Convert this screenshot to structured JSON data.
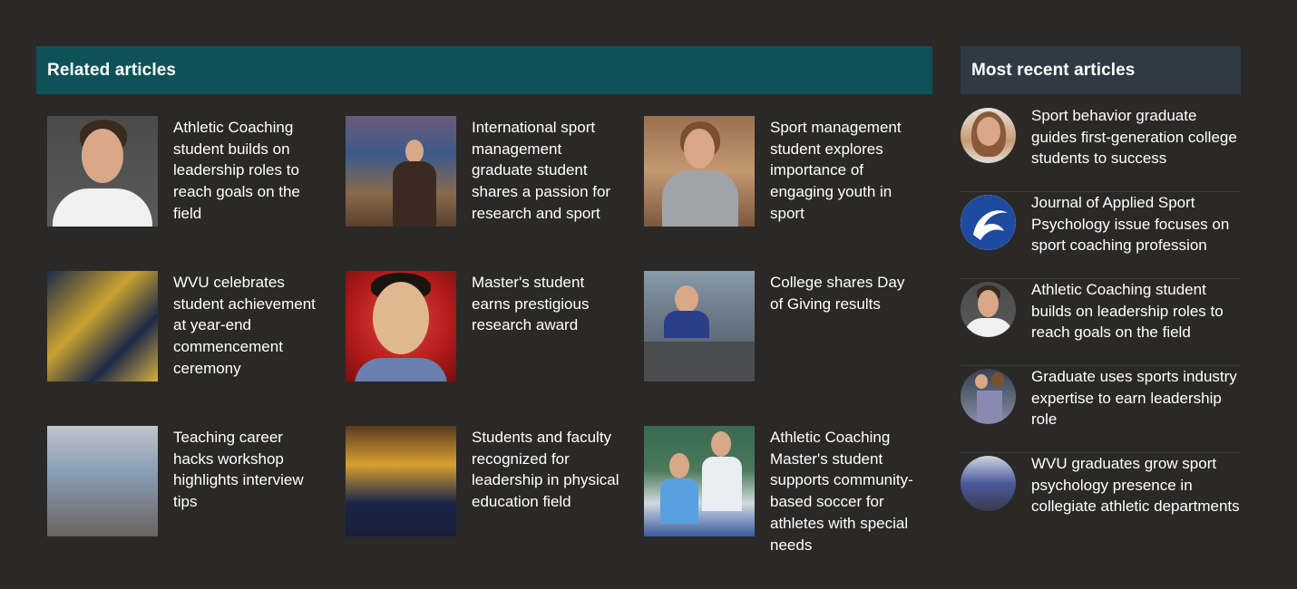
{
  "related": {
    "heading": "Related articles",
    "articles": [
      {
        "title": "Athletic Coaching student builds on leadership roles to reach goals on the field",
        "image": "student-portrait-photo"
      },
      {
        "title": "International sport management graduate student shares a passion for research and sport",
        "image": "arena-photo"
      },
      {
        "title": "Sport management student explores importance of engaging youth in sport",
        "image": "gym-portrait-photo"
      },
      {
        "title": "WVU celebrates student achievement at year-end commencement ceremony",
        "image": "commencement-photo"
      },
      {
        "title": "Master's student earns prestigious research award",
        "image": "smiling-student-photo"
      },
      {
        "title": "College shares Day of Giving results",
        "image": "meeting-photo"
      },
      {
        "title": "Teaching career hacks workshop highlights interview tips",
        "image": "workshop-photo"
      },
      {
        "title": "Students and faculty recognized for leadership in physical education field",
        "image": "booth-photo"
      },
      {
        "title": "Athletic Coaching Master's student supports community-based soccer for athletes with special needs",
        "image": "soccer-photo"
      }
    ]
  },
  "recent": {
    "heading": "Most recent articles",
    "articles": [
      {
        "title": "Sport behavior graduate guides first-generation college students to success",
        "image": "woman-avatar"
      },
      {
        "title": "Journal of Applied Sport Psychology issue focuses on sport coaching profession",
        "image": "journal-logo-avatar"
      },
      {
        "title": "Athletic Coaching student builds on leadership roles to reach goals on the field",
        "image": "student-avatar"
      },
      {
        "title": "Graduate uses sports industry expertise to earn leadership role",
        "image": "team-jersey-avatar"
      },
      {
        "title": "WVU graduates grow sport psychology presence in collegiate athletic departments",
        "image": "classroom-avatar"
      }
    ]
  },
  "colors": {
    "background": "#2a2927",
    "related_header": "#0e5257",
    "recent_header": "#2f3a44",
    "text": "#ffffff"
  }
}
